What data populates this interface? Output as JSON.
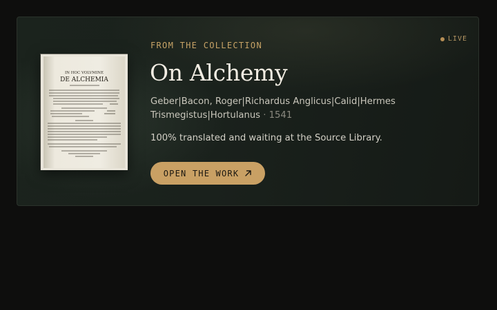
{
  "card": {
    "eyebrow": "FROM THE COLLECTION",
    "live_label": "LIVE",
    "title": "On Alchemy",
    "authors": "Geber|Bacon, Roger|Richardus Anglicus|Calid|Hermes Trismegistus|Hortulanus",
    "year_separator": "·",
    "year": "1541",
    "description": "100% translated and waiting at the Source Library.",
    "button_label": "OPEN THE WORK",
    "button_icon": "arrow-up-right-icon",
    "thumbnail": {
      "line1": "IN HOC VOLVMINE",
      "line2": "DE ALCHEMIA"
    }
  },
  "colors": {
    "accent": "#c9a064",
    "eyebrow": "#c7a366",
    "live_dot": "#b68e55",
    "title": "#f1ece2",
    "background": "#0e0e0d"
  }
}
